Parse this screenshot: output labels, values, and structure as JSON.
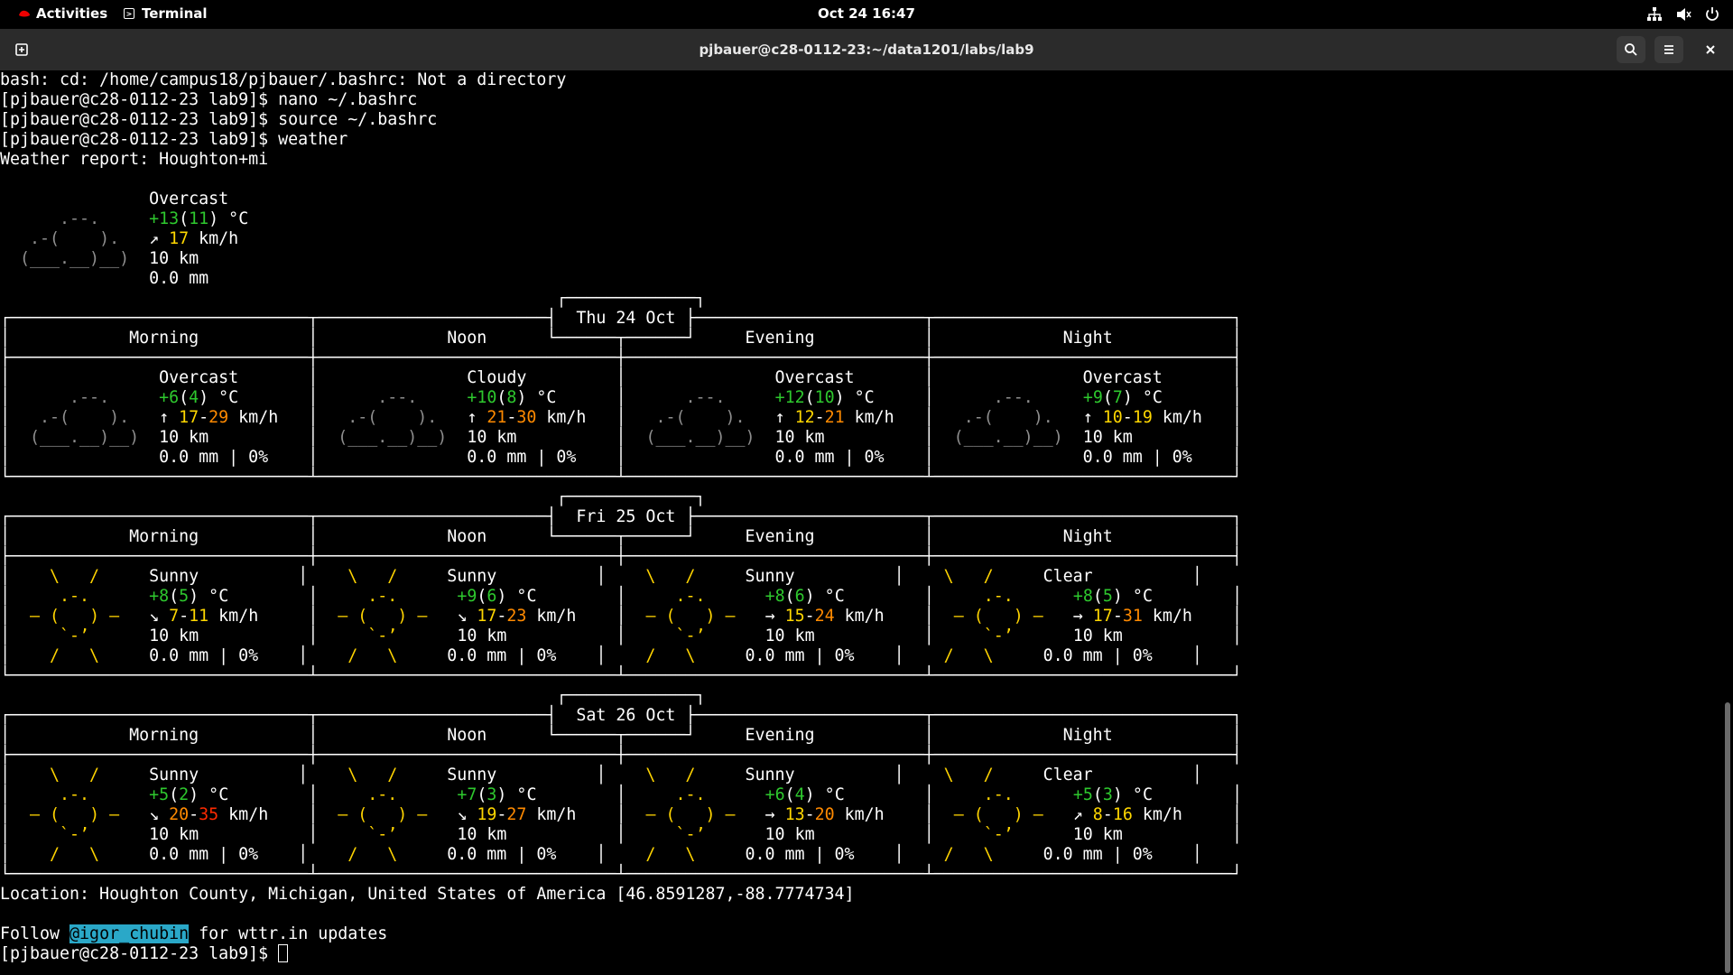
{
  "topbar": {
    "activities": "Activities",
    "app_name": "Terminal",
    "clock": "Oct 24  16:47"
  },
  "window": {
    "title": "pjbauer@c28-0112-23:~/data1201/labs/lab9"
  },
  "terminal": {
    "lines": [
      "bash: cd: /home/campus18/pjbauer/.bashrc: Not a directory",
      "[pjbauer@c28-0112-23 lab9]$ nano ~/.bashrc",
      "[pjbauer@c28-0112-23 lab9]$ source ~/.bashrc",
      "[pjbauer@c28-0112-23 lab9]$ weather",
      "Weather report: Houghton+mi",
      "",
      "               Overcast",
      "      .--.     +13(11) °C",
      "   .-(    ).   ↗ 17 km/h",
      "  (___.__)__)  10 km",
      "               0.0 mm",
      "                                                        ┌─────────────┐",
      "┌──────────────────────────────┬───────────────────────┤  Thu 24 Oct ├───────────────────────┬──────────────────────────────┐",
      "│            Morning           │             Noon      └──────┬──────┘     Evening           │             Night            │",
      "├──────────────────────────────┼──────────────────────────────┼──────────────────────────────┼──────────────────────────────┤",
      "│               Overcast       │               Cloudy         │               Overcast       │               Overcast       │",
      "│      .--.     +6(4) °C       │      .--.     +10(8) °C      │      .--.     +12(10) °C     │      .--.     +9(7) °C       │",
      "│   .-(    ).   ↑ 17-29 km/h   │   .-(    ).   ↑ 21-30 km/h   │   .-(    ).   ↑ 12-21 km/h   │   .-(    ).   ↑ 10-19 km/h   │",
      "│  (___.__)__)  10 km          │  (___.__)__)  10 km          │  (___.__)__)  10 km          │  (___.__)__)  10 km          │",
      "│               0.0 mm | 0%    │               0.0 mm | 0%    │               0.0 mm | 0%    │               0.0 mm | 0%    │",
      "└──────────────────────────────┴──────────────────────────────┴──────────────────────────────┴──────────────────────────────┘",
      "                                                        ┌─────────────┐",
      "┌──────────────────────────────┬───────────────────────┤  Fri 25 Oct ├───────────────────────┬──────────────────────────────┐",
      "│            Morning           │             Noon      └──────┬──────┘     Evening           │             Night            │",
      "├──────────────────────────────┼──────────────────────────────┼──────────────────────────────┼──────────────────────────────┤",
      "│    \\   /     Sunny          │    \\   /     Sunny          │    \\   /     Sunny          │    \\   /     Clear          │",
      "│     .-.      +8(5) °C        │     .-.      +9(6) °C        │     .-.      +8(6) °C        │     .-.      +8(5) °C        │",
      "│  ― (   ) ―   ↘ 7-11 km/h     │  ― (   ) ―   ↘ 17-23 km/h    │  ― (   ) ―   → 15-24 km/h    │  ― (   ) ―   → 17-31 km/h    │",
      "│     `-’      10 km           │     `-’      10 km           │     `-’      10 km           │     `-’      10 km           │",
      "│    /   \\     0.0 mm | 0%    │    /   \\     0.0 mm | 0%    │    /   \\     0.0 mm | 0%    │    /   \\     0.0 mm | 0%    │",
      "└──────────────────────────────┴──────────────────────────────┴──────────────────────────────┴──────────────────────────────┘",
      "                                                        ┌─────────────┐",
      "┌──────────────────────────────┬───────────────────────┤  Sat 26 Oct ├───────────────────────┬──────────────────────────────┐",
      "│            Morning           │             Noon      └──────┬──────┘     Evening           │             Night            │",
      "├──────────────────────────────┼──────────────────────────────┼──────────────────────────────┼──────────────────────────────┤",
      "│    \\   /     Sunny          │    \\   /     Sunny          │    \\   /     Sunny          │    \\   /     Clear          │",
      "│     .-.      +5(2) °C        │     .-.      +7(3) °C        │     .-.      +6(4) °C        │     .-.      +5(3) °C        │",
      "│  ― (   ) ―   ↘ 20-35 km/h    │  ― (   ) ―   ↘ 19-27 km/h    │  ― (   ) ―   → 13-20 km/h    │  ― (   ) ―   ↗ 8-16 km/h     │",
      "│     `-’      10 km           │     `-’      10 km           │     `-’      10 km           │     `-’      10 km           │",
      "│    /   \\     0.0 mm | 0%    │    /   \\     0.0 mm | 0%    │    /   \\     0.0 mm | 0%    │    /   \\     0.0 mm | 0%    │",
      "└──────────────────────────────┴──────────────────────────────┴──────────────────────────────┴──────────────────────────────┘",
      "Location: Houghton County, Michigan, United States of America [46.8591287,-88.7774734]",
      "",
      "Follow @igor_chubin for wttr.in updates",
      "[pjbauer@c28-0112-23 lab9]$ "
    ],
    "highlights": [
      {
        "text": "@igor_chubin",
        "class": "hl"
      }
    ]
  },
  "colors": {
    "background": "#000000",
    "text": "#ffffff",
    "temp_green": "#2ec82e",
    "wind_yellow": "#ffd700",
    "wind_orange": "#ff8a00",
    "wind_red": "#ff2a00",
    "sun": "#ffd400",
    "cloud": "#8e8e8e",
    "link_highlight": "#2aa8c8"
  },
  "icons": [
    "redhat-icon",
    "terminal-icon",
    "new-tab-icon",
    "search-icon",
    "hamburger-menu-icon",
    "close-icon",
    "network-icon",
    "volume-icon",
    "power-icon"
  ]
}
